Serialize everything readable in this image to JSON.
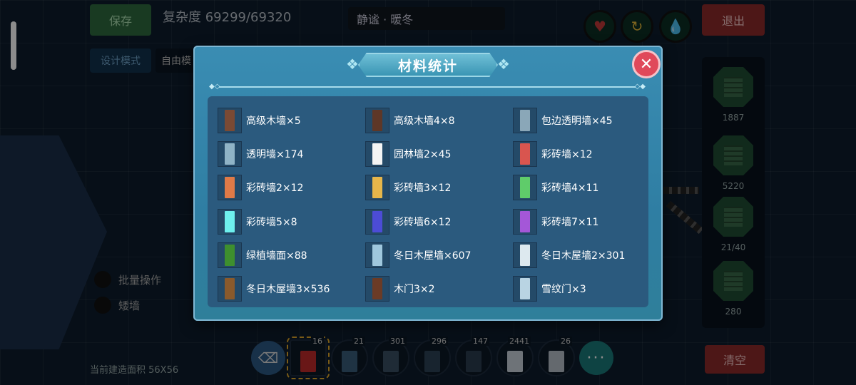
{
  "hud": {
    "save_label": "保存",
    "complexity": "复杂度 69299/69320",
    "scene_name": "静谧 · 暖冬",
    "exit_label": "退出",
    "design_mode_label": "设计模式",
    "free_label": "自由模",
    "batch_label": "批量操作",
    "low_wall_label": "矮墙",
    "build_area": "当前建造面积 56X56",
    "clear_label": "清空",
    "more_label": "···",
    "colors": {
      "save": "#2f6b3f",
      "exit": "#8d2a2a",
      "clear": "#8d2a2a",
      "heart": "#c43a3a",
      "refresh": "#e0b437",
      "drop": "#2aa1c9"
    }
  },
  "right_panel": {
    "counts": [
      "1887",
      "5220",
      "21/40",
      "280"
    ]
  },
  "toolbar": {
    "slots": [
      {
        "count": "16",
        "color": "#c02b2b"
      },
      {
        "count": "21",
        "color": "#3a5e7a"
      },
      {
        "count": "301",
        "color": "#3a4f63"
      },
      {
        "count": "296",
        "color": "#2d4256"
      },
      {
        "count": "147",
        "color": "#2a3c4f"
      },
      {
        "count": "2441",
        "color": "#c9d2da"
      },
      {
        "count": "26",
        "color": "#b6c0c8"
      }
    ]
  },
  "modal": {
    "title": "材料统计",
    "close_icon": "close-x-icon",
    "items": [
      {
        "label": "高级木墙×5",
        "color": "#7a4a34"
      },
      {
        "label": "高级木墙4×8",
        "color": "#5e3727"
      },
      {
        "label": "包边透明墙×45",
        "color": "#8aa7b8"
      },
      {
        "label": "透明墙×174",
        "color": "#8fb3c6"
      },
      {
        "label": "园林墙2×45",
        "color": "#f4f4f4"
      },
      {
        "label": "彩砖墙×12",
        "color": "#d9554f"
      },
      {
        "label": "彩砖墙2×12",
        "color": "#e07a47"
      },
      {
        "label": "彩砖墙3×12",
        "color": "#e7b64a"
      },
      {
        "label": "彩砖墙4×11",
        "color": "#5fcc6a"
      },
      {
        "label": "彩砖墙5×8",
        "color": "#6ef0ee"
      },
      {
        "label": "彩砖墙6×12",
        "color": "#4c4cd6"
      },
      {
        "label": "彩砖墙7×11",
        "color": "#a457d8"
      },
      {
        "label": "绿植墙面×88",
        "color": "#3e8f2e"
      },
      {
        "label": "冬日木屋墙×607",
        "color": "#9fc7dd"
      },
      {
        "label": "冬日木屋墙2×301",
        "color": "#dde9ef"
      },
      {
        "label": "冬日木屋墙3×536",
        "color": "#8a5a2c"
      },
      {
        "label": "木门3×2",
        "color": "#6b3b26"
      },
      {
        "label": "雪纹门×3",
        "color": "#b9d4e3"
      }
    ]
  }
}
